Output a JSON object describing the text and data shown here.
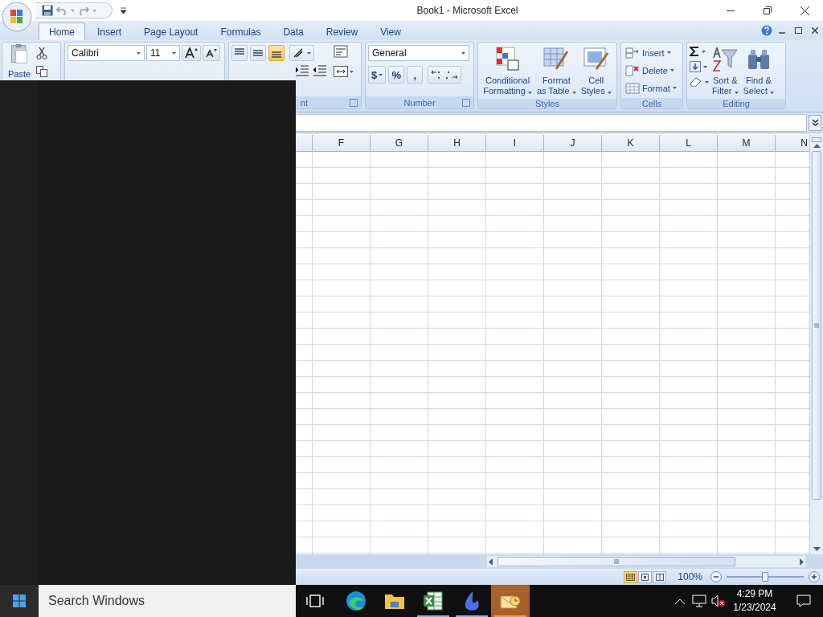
{
  "window": {
    "title": "Book1 - Microsoft Excel"
  },
  "ribbon_tabs": [
    {
      "label": "Home",
      "selected": true
    },
    {
      "label": "Insert",
      "selected": false
    },
    {
      "label": "Page Layout",
      "selected": false
    },
    {
      "label": "Formulas",
      "selected": false
    },
    {
      "label": "Data",
      "selected": false
    },
    {
      "label": "Review",
      "selected": false
    },
    {
      "label": "View",
      "selected": false
    }
  ],
  "ribbon": {
    "clipboard": {
      "paste_label": "Paste"
    },
    "font": {
      "name": "Calibri",
      "size": "11"
    },
    "alignment": {
      "group_label": "nt",
      "vertical_align": [
        {
          "kind": "top",
          "selected": false
        },
        {
          "kind": "middle",
          "selected": false
        },
        {
          "kind": "bottom",
          "selected": true
        }
      ]
    },
    "number": {
      "format": "General",
      "symbols": [
        "$",
        "%",
        ","
      ],
      "group_label": "Number"
    },
    "styles": {
      "group_label": "Styles",
      "buttons": [
        {
          "kind": "conditional",
          "lines": [
            "Conditional",
            "Formatting"
          ]
        },
        {
          "kind": "table",
          "lines": [
            "Format",
            "as Table"
          ]
        },
        {
          "kind": "cellstyle",
          "lines": [
            "Cell",
            "Styles"
          ]
        }
      ]
    },
    "cells": {
      "group_label": "Cells",
      "buttons": [
        {
          "kind": "insert",
          "label": "Insert"
        },
        {
          "kind": "delete",
          "label": "Delete"
        },
        {
          "kind": "format",
          "label": "Format"
        }
      ]
    },
    "editing": {
      "group_label": "Editing",
      "buttons": [
        {
          "kind": "sort",
          "lines": [
            "Sort &",
            "Filter"
          ]
        },
        {
          "kind": "find",
          "lines": [
            "Find &",
            "Select"
          ]
        }
      ]
    }
  },
  "sheet": {
    "columns": [
      "F",
      "G",
      "H",
      "I",
      "J",
      "K",
      "L",
      "M",
      "N"
    ]
  },
  "status_bar": {
    "views": [
      {
        "kind": "normal",
        "selected": true
      },
      {
        "kind": "layout",
        "selected": false
      },
      {
        "kind": "break",
        "selected": false
      }
    ],
    "zoom": {
      "reading": "100%",
      "level": 0.5
    }
  },
  "start_menu": {
    "search": {
      "placeholder": "Search Windows"
    }
  },
  "taskbar": {
    "apps": [
      {
        "kind": "taskview",
        "running": false,
        "active": false
      },
      {
        "kind": "edge",
        "running": false,
        "active": false
      },
      {
        "kind": "folder",
        "running": false,
        "active": false
      },
      {
        "kind": "excel",
        "running": true,
        "active": false
      },
      {
        "kind": "app",
        "running": true,
        "active": false
      },
      {
        "kind": "outlook",
        "running": true,
        "active": true
      }
    ],
    "clock": {
      "time": "4:29 PM",
      "date": "1/23/2024"
    }
  }
}
